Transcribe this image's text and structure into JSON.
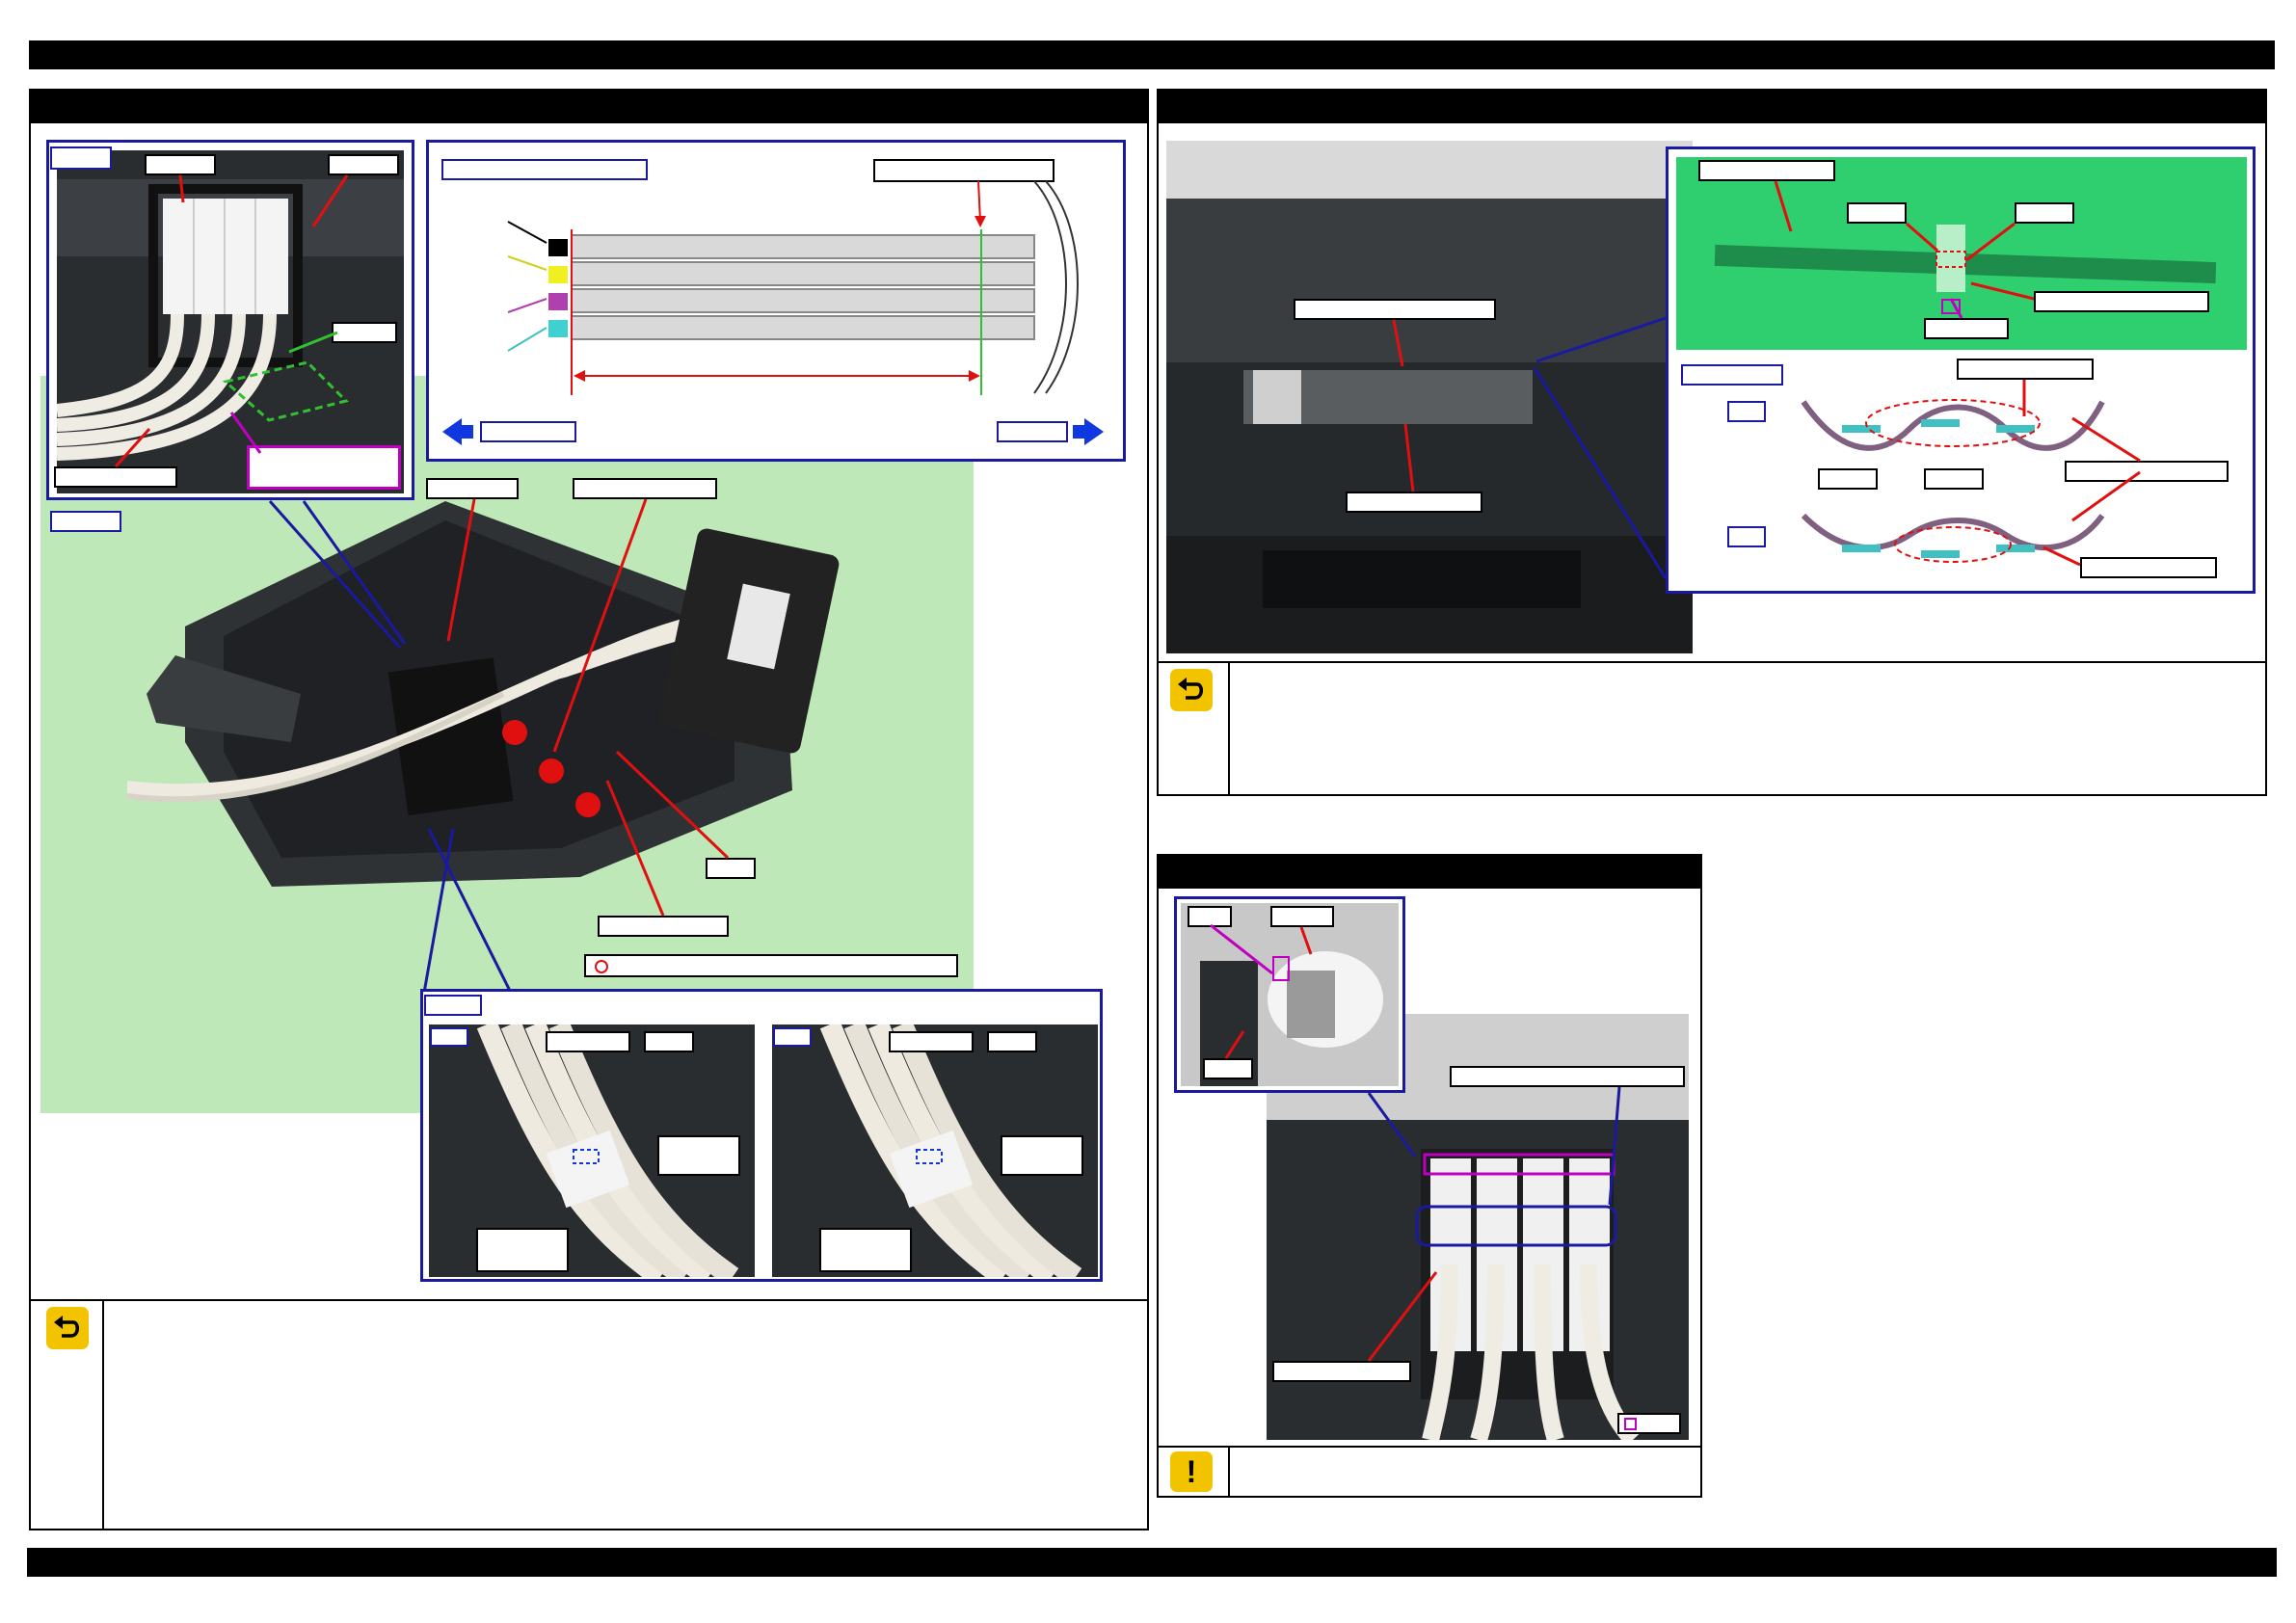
{
  "icons": {
    "reassembly": "reassembly-icon",
    "caution": "caution-icon",
    "caution_glyph": "!"
  },
  "colors": {
    "frame": "#000000",
    "callout_border": "#1a1aa0",
    "marker": "#c000c0",
    "arrow_red": "#e01010",
    "arrow_blue": "#1038e0",
    "ink_black": "#000000",
    "ink_yellow": "#f0f020",
    "ink_magenta": "#b040b0",
    "ink_cyan": "#40d0d0",
    "photo_background": "#bfe8b8"
  }
}
